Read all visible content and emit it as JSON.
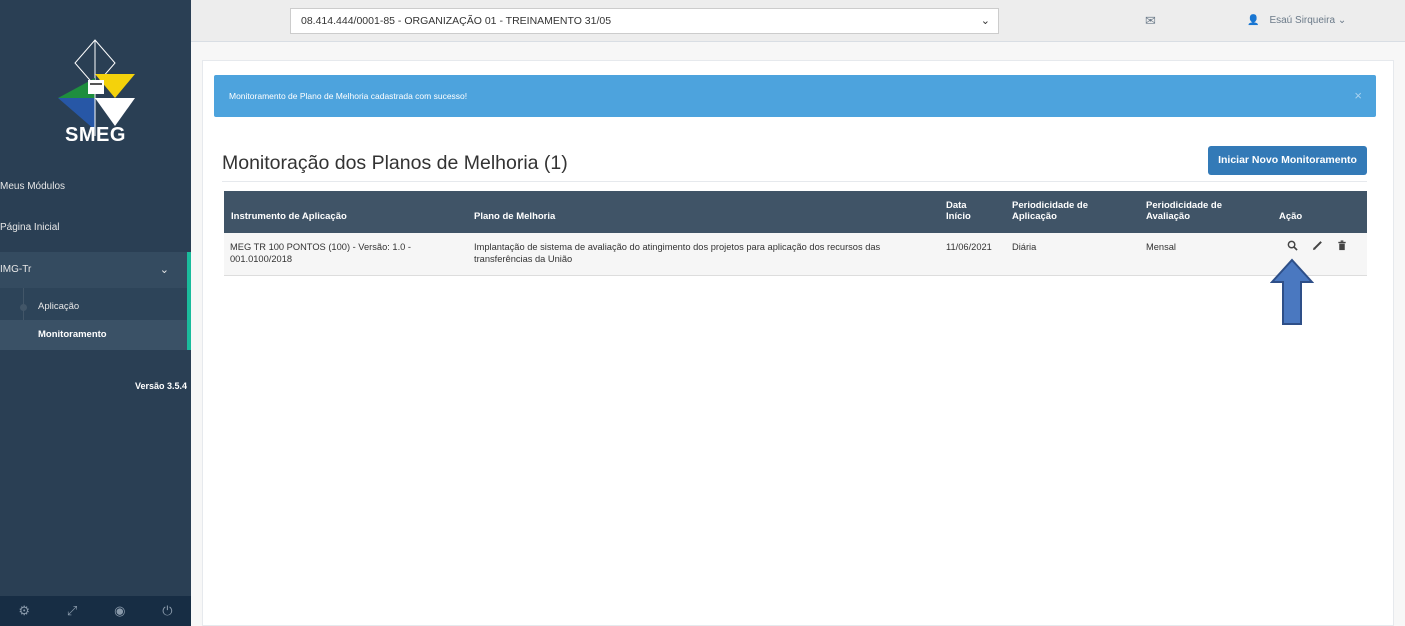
{
  "sidebar": {
    "logo_text": "SMEG",
    "items": [
      {
        "label": "Meus Módulos"
      },
      {
        "label": "Página Inicial"
      },
      {
        "label": "IMG-Tr"
      }
    ],
    "submenu": [
      {
        "label": "Aplicação"
      },
      {
        "label": "Monitoramento"
      }
    ],
    "version": "Versão 3.5.4",
    "footer_icons": [
      "gear-icon",
      "fullscreen-icon",
      "eye-slash-icon",
      "power-icon"
    ]
  },
  "topbar": {
    "organization": "08.414.444/0001-85 - ORGANIZAÇÃO 01 - TREINAMENTO 31/05",
    "user_name": "Esaú Sirqueira"
  },
  "alert": {
    "message": "Monitoramento de Plano de Melhoria cadastrada com sucesso!",
    "close": "×"
  },
  "page": {
    "title": "Monitoração dos Planos de Melhoria (1)",
    "new_button": "Iniciar Novo Monitoramento"
  },
  "table": {
    "columns": [
      "Instrumento de Aplicação",
      "Plano de Melhoria",
      "Data Início",
      "Periodicidade de Aplicação",
      "Periodicidade de Avaliação",
      "Ação"
    ],
    "rows": [
      {
        "instrumento": "MEG TR 100 PONTOS (100) - Versão: 1.0 - 001.0100/2018",
        "plano": "Implantação de sistema de avaliação do atingimento dos projetos para aplicação dos recursos das transferências da União",
        "data_inicio": "11/06/2021",
        "per_aplicacao": "Diária",
        "per_avaliacao": "Mensal"
      }
    ]
  },
  "colors": {
    "sidebar": "#2a3f54",
    "accent": "#1abb9c",
    "alert": "#4da3dd",
    "primary_button": "#337ab7",
    "table_header": "#405467"
  }
}
